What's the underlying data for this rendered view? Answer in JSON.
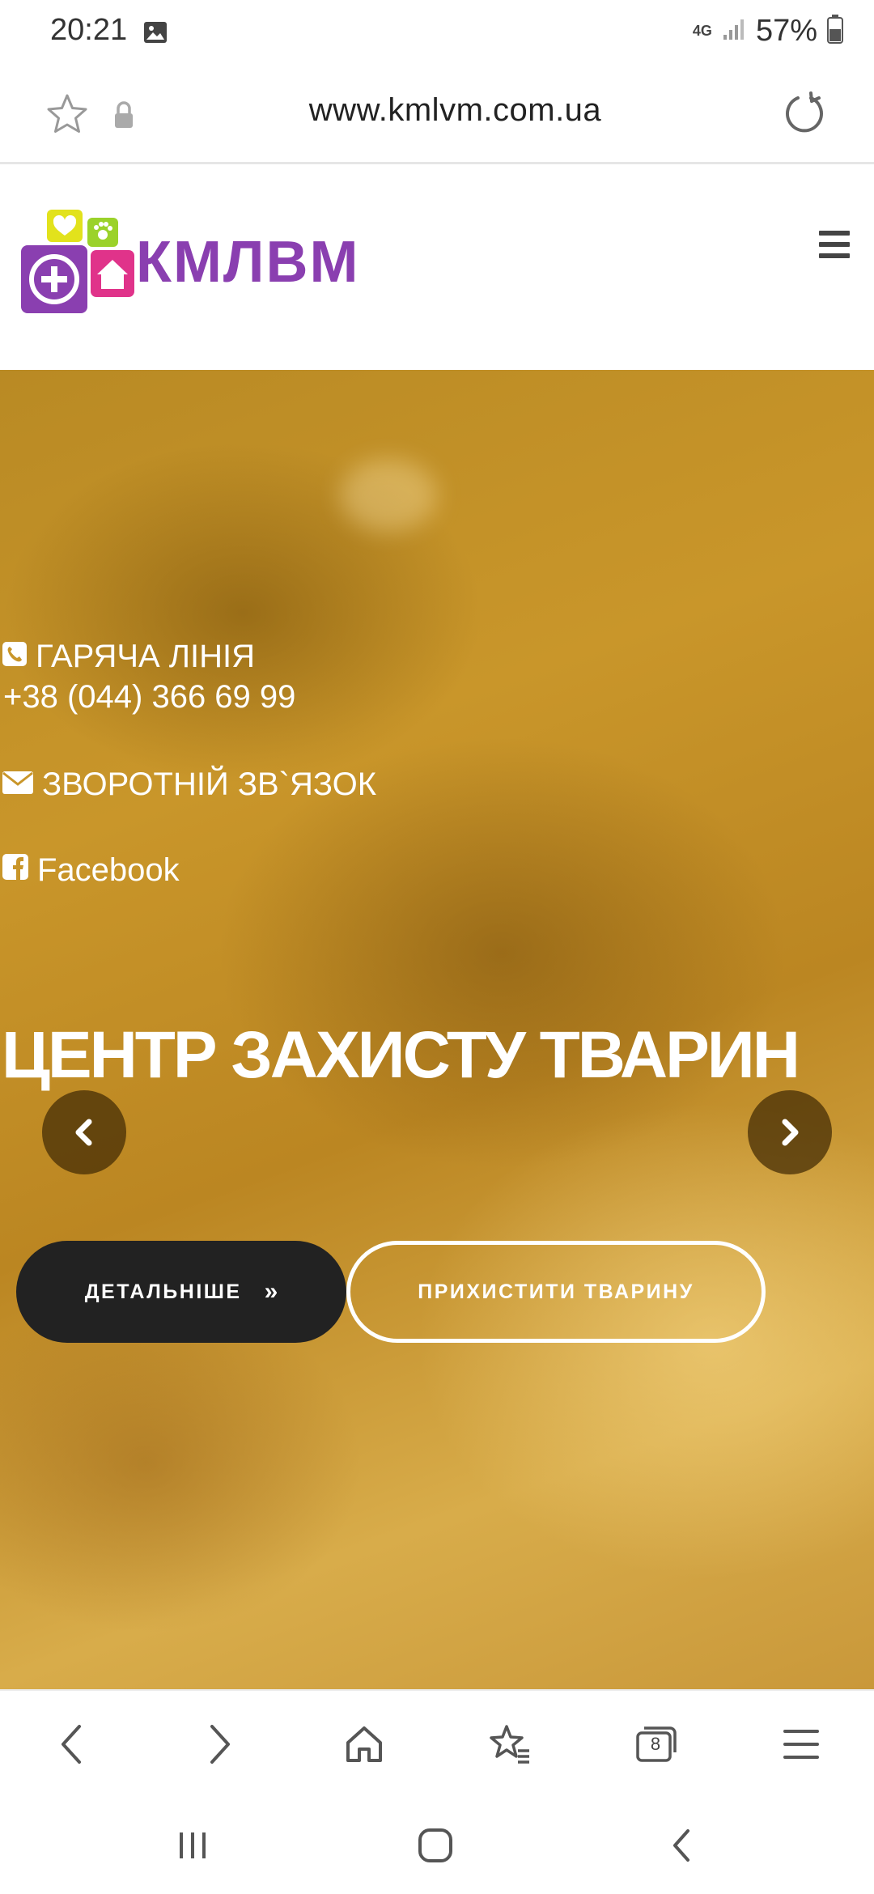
{
  "status_bar": {
    "time": "20:21",
    "network": "4G",
    "battery": "57%",
    "icons": [
      "gallery-icon",
      "signal-icon",
      "battery-icon"
    ]
  },
  "address_bar": {
    "url": "www.kmlvm.com.ua",
    "icons": [
      "star-icon",
      "lock-icon",
      "reload-icon"
    ]
  },
  "site_header": {
    "logo_text": "КМЛВМ",
    "menu_icon": "hamburger-icon",
    "logo_colors": [
      "#8a3fb0",
      "#e0e01a",
      "#9bd22a",
      "#e0338a"
    ]
  },
  "hero": {
    "hotline_label": "ГАРЯЧА ЛІНІЯ",
    "hotline_phone": "+38 (044) 366 69 99",
    "feedback_label": "ЗВОРОТНІЙ ЗВ`ЯЗОК",
    "facebook_label": "Facebook",
    "title": "ЦЕНТР ЗАХИСТУ ТВАРИН",
    "details_button": "ДЕТАЛЬНІШЕ",
    "details_chevron": "»",
    "shelter_button": "ПРИХИСТИТИ ТВАРИНУ",
    "overlay_color": "#c9962a"
  },
  "browser_toolbar": {
    "tabs_count": "8",
    "icons": [
      "back-icon",
      "forward-icon",
      "home-icon",
      "bookmarks-icon",
      "tabs-icon",
      "menu-icon"
    ]
  },
  "system_nav": {
    "icons": [
      "recents-icon",
      "home-icon",
      "back-icon"
    ]
  }
}
